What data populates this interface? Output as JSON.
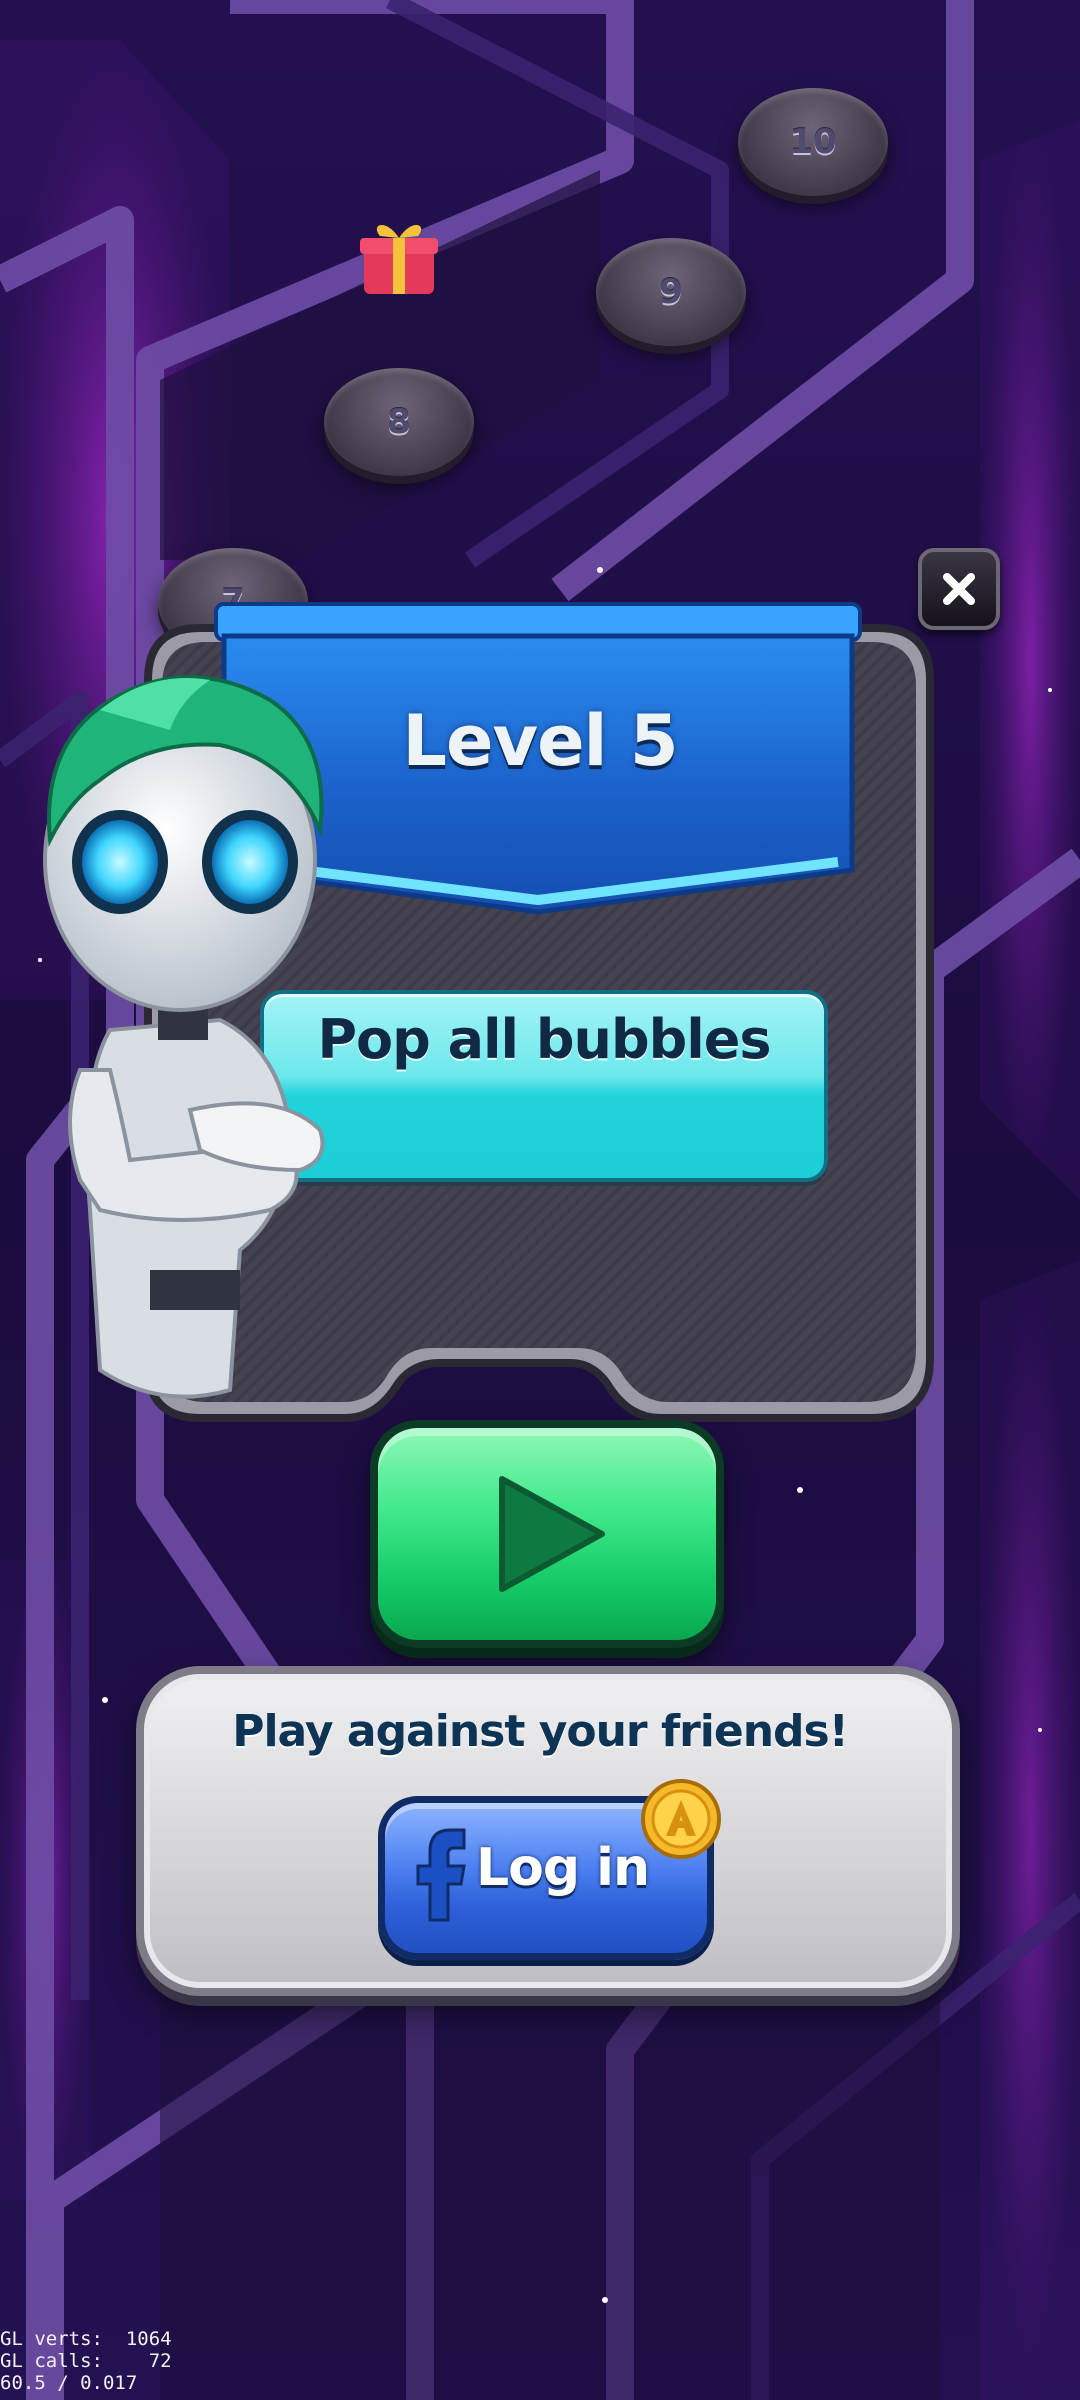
{
  "map": {
    "levels": [
      {
        "id": "level-7",
        "label": "7"
      },
      {
        "id": "level-8",
        "label": "8"
      },
      {
        "id": "level-9",
        "label": "9"
      },
      {
        "id": "level-10",
        "label": "10"
      }
    ]
  },
  "dialog": {
    "title": "Level 5",
    "goal": "Pop all bubbles",
    "close_icon": "close-icon",
    "play_icon": "play-icon"
  },
  "friends": {
    "prompt": "Play against your friends!",
    "login_label": "Log in",
    "login_icon": "facebook-icon",
    "reward_icon": "coin-icon"
  },
  "debug": {
    "line1": "GL verts:  1064",
    "line2": "GL calls:    72",
    "line3": "60.5 / 0.017"
  },
  "colors": {
    "background": "#1a0b3a",
    "banner": "#1f6fd6",
    "goal": "#2fd9e0",
    "play": "#2ee07c",
    "login": "#3a6be6"
  }
}
